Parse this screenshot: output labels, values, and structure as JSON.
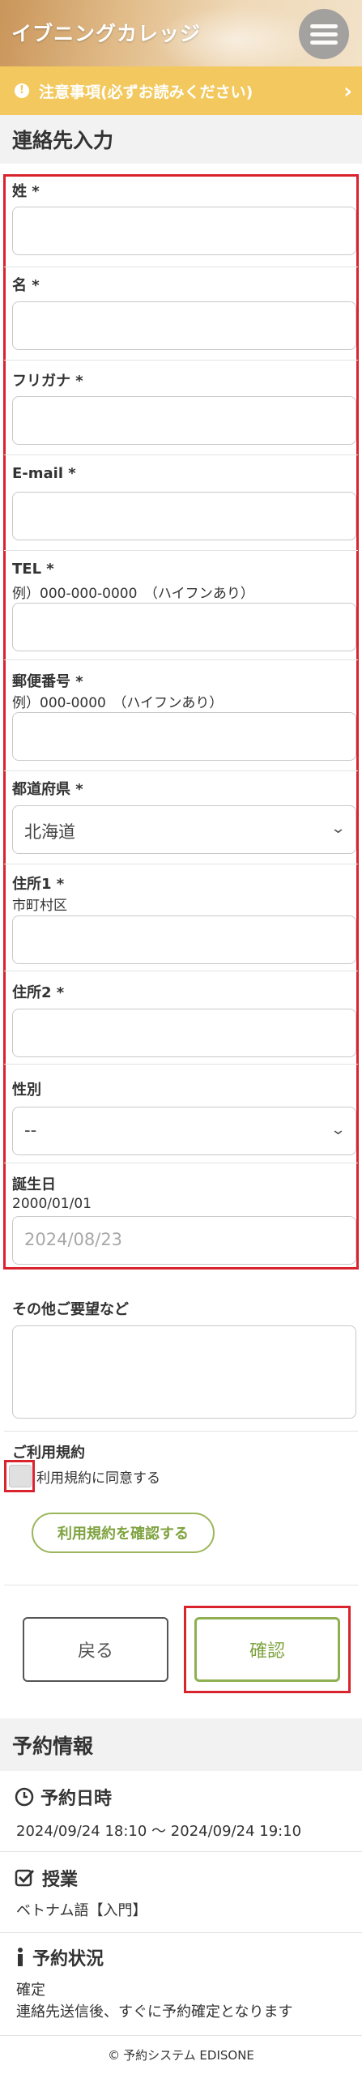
{
  "header": {
    "brand": "イブニングカレッジ"
  },
  "notice": {
    "text": "注意事項(必ずお読みください)"
  },
  "contact": {
    "title": "連絡先入力",
    "fields": {
      "last_name": {
        "label": "姓 *"
      },
      "first_name": {
        "label": "名 *"
      },
      "furigana": {
        "label": "フリガナ *"
      },
      "email": {
        "label": "E-mail *"
      },
      "tel": {
        "label": "TEL *",
        "hint": "例）000-000-0000　（ハイフンあり）"
      },
      "postal": {
        "label": "郵便番号 *",
        "hint": "例）000-0000　（ハイフンあり）"
      },
      "prefecture": {
        "label": "都道府県 *",
        "value": "北海道"
      },
      "address1": {
        "label": "住所1 *",
        "hint": "市町村区"
      },
      "address2": {
        "label": "住所2 *"
      },
      "gender": {
        "label": "性別",
        "value": "--"
      },
      "birthday": {
        "label": "誕生日",
        "hint": "2000/01/01",
        "placeholder": "2024/08/23"
      }
    },
    "requests": {
      "label": "その他ご要望など"
    }
  },
  "terms": {
    "title": "ご利用規約",
    "agree_label": "利用規約に同意する",
    "check_button": "利用規約を確認する"
  },
  "actions": {
    "back": "戻る",
    "confirm": "確認"
  },
  "reservation": {
    "title": "予約情報",
    "datetime_title": "予約日時",
    "datetime_value": "2024/09/24 18:10 〜 2024/09/24 19:10",
    "class_title": "授業",
    "class_value": "ベトナム語【入門】",
    "status_title": "予約状況",
    "status_value": "確定",
    "status_note": "連絡先送信後、すぐに予約確定となります"
  },
  "footer": {
    "text": "予約システム EDISONE"
  },
  "colors": {
    "notice": "#f3c95f",
    "accent_green": "#7fa340",
    "highlight_red": "#d9232d"
  }
}
